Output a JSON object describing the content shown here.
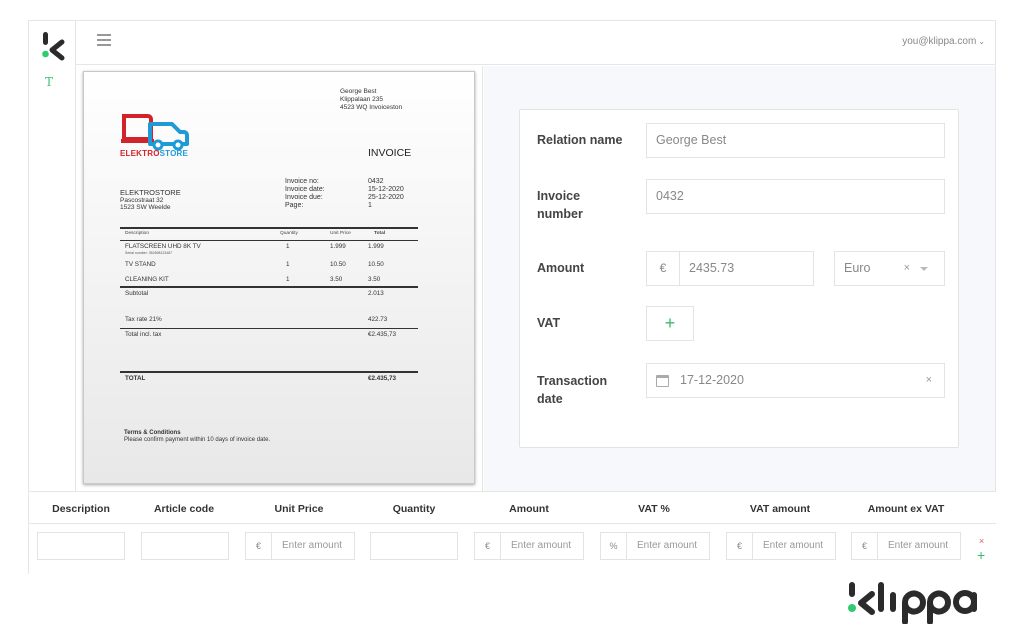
{
  "header": {
    "user_email": "you@klippa.com",
    "user_chevron": "⌄"
  },
  "rail": {
    "text_tool": "T"
  },
  "colors": {
    "accent_green": "#3cb96b",
    "danger_red": "#e8585d",
    "brand_red": "#d2232a",
    "brand_blue": "#1e9ad6"
  },
  "invoice_doc": {
    "recipient": {
      "name": "George Best",
      "street": "Klippalaan 235",
      "city": "4523 WQ Invoiceston"
    },
    "brand": {
      "part1": "ELEKTRO",
      "part2": "STORE"
    },
    "title": "INVOICE",
    "seller": {
      "name": "ELEKTROSTORE",
      "street": "Pascostraat 32",
      "city": "1523 SW Weelde"
    },
    "meta_labels": [
      "Invoice no:",
      "Invoice date:",
      "Invoice due:",
      "Page:"
    ],
    "meta_values": [
      "0432",
      "15-12-2020",
      "25-12-2020",
      "1"
    ],
    "table_headers": {
      "description": "Description",
      "quantity": "Quantity",
      "unit_price": "Unit Price",
      "total": "Total"
    },
    "items": [
      {
        "description": "FLATSCREEN UHD 8K TV",
        "serial": "Serial number: 352698123487",
        "quantity": "1",
        "unit_price": "1.999",
        "total": "1.999"
      },
      {
        "description": "TV STAND",
        "quantity": "1",
        "unit_price": "10.50",
        "total": "10.50"
      },
      {
        "description": "CLEANING KIT",
        "quantity": "1",
        "unit_price": "3.50",
        "total": "3.50"
      }
    ],
    "subtotal_label": "Subtotal",
    "subtotal_value": "2.013",
    "tax_label": "Tax rate 21%",
    "tax_value": "422.73",
    "total_incl_label": "Total incl. tax",
    "total_incl_value": "€2.435,73",
    "grand_total_label": "TOTAL",
    "grand_total_value": "€2.435,73",
    "terms_title": "Terms & Conditions",
    "terms_text": "Please confirm payment within 10 days of invoice date."
  },
  "form": {
    "relation_name": {
      "label": "Relation name",
      "value": "George Best"
    },
    "invoice_number": {
      "label_line1": "Invoice",
      "label_line2": "number",
      "value": "0432"
    },
    "amount": {
      "label": "Amount",
      "currency_symbol": "€",
      "value": "2435.73",
      "currency": "Euro",
      "clear_icon": "×"
    },
    "vat": {
      "label": "VAT",
      "add_icon": "+"
    },
    "transaction_date": {
      "label_line1": "Transaction",
      "label_line2": "date",
      "value": "17-12-2020",
      "clear_icon": "×"
    }
  },
  "line_items": {
    "headers": [
      "Description",
      "Article code",
      "Unit Price",
      "Quantity",
      "Amount",
      "VAT %",
      "VAT amount",
      "Amount ex VAT"
    ],
    "placeholder": "Enter amount",
    "euro": "€",
    "percent": "%",
    "remove_icon": "×",
    "add_icon": "+"
  }
}
